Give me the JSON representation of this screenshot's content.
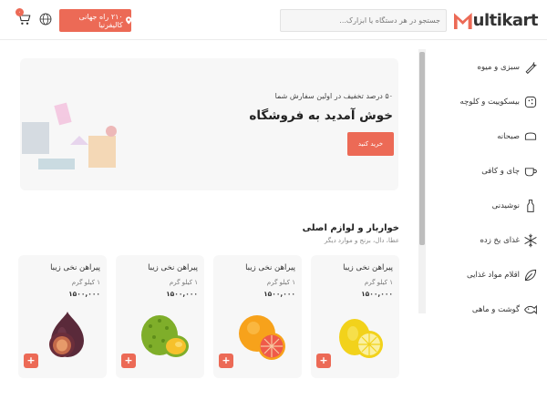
{
  "header": {
    "logo_text": "ultikart",
    "search_placeholder": "جستجو در هر دستگاه یا ابزارک...",
    "location_label": "۲۱۰ راه جهانی کالیفرنیا",
    "cart_count": "۰",
    "accent_color": "#ec6a56"
  },
  "sidebar": {
    "items": [
      {
        "label": "سبزی و میوه",
        "icon": "vegetable-icon"
      },
      {
        "label": "بیسکوییت و کلوچه",
        "icon": "cookie-icon"
      },
      {
        "label": "صبحانه",
        "icon": "bread-icon"
      },
      {
        "label": "چای و کافی",
        "icon": "cup-icon"
      },
      {
        "label": "نوشیدنی",
        "icon": "bottle-icon"
      },
      {
        "label": "غذای یخ زده",
        "icon": "snowflake-icon"
      },
      {
        "label": "اقلام مواد غذایی",
        "icon": "leaf-icon"
      },
      {
        "label": "گوشت و ماهی",
        "icon": "fish-icon"
      }
    ]
  },
  "banner": {
    "subtitle": "۵۰ درصد تخفیف در اولین سفارش شما",
    "title": "خوش آمدید به فروشگاه",
    "button_label": "خرید کنید"
  },
  "section": {
    "title": "خواربار و لوازم اصلی",
    "subtitle": "عطا، دال، برنج و موارد دیگر"
  },
  "products": [
    {
      "name": "پیراهن نخی زیبا",
      "weight": "۱ کیلو گرم",
      "price": "۱۵۰۰,۰۰۰",
      "image": "lemon"
    },
    {
      "name": "پیراهن نخی زیبا",
      "weight": "۱ کیلو گرم",
      "price": "۱۵۰۰,۰۰۰",
      "image": "grapefruit"
    },
    {
      "name": "پیراهن نخی زیبا",
      "weight": "۱ کیلو گرم",
      "price": "۱۵۰۰,۰۰۰",
      "image": "durian"
    },
    {
      "name": "پیراهن نخی زیبا",
      "weight": "۱ کیلو گرم",
      "price": "۱۵۰۰,۰۰۰",
      "image": "fig"
    }
  ],
  "add_button_label": "+"
}
